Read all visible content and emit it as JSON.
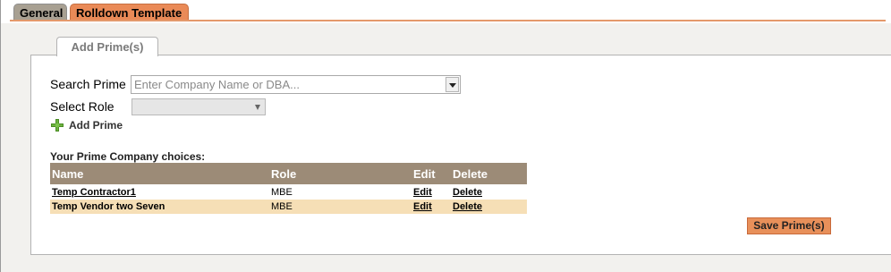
{
  "tabs": [
    {
      "label": "General",
      "active": false
    },
    {
      "label": "Rolldown Template",
      "active": true
    }
  ],
  "section": {
    "title": "Add Prime(s)"
  },
  "search": {
    "label": "Search Prime",
    "placeholder": "Enter Company Name or DBA...",
    "value": ""
  },
  "role": {
    "label": "Select Role",
    "selected": ""
  },
  "add_prime": {
    "label": "Add Prime",
    "icon": "plus-icon"
  },
  "choices": {
    "label": "Your Prime Company choices:",
    "columns": {
      "name": "Name",
      "role": "Role",
      "edit": "Edit",
      "delete": "Delete"
    },
    "rows": [
      {
        "name": "Temp Contractor1",
        "role": "MBE",
        "edit": "Edit",
        "delete": "Delete"
      },
      {
        "name": "Temp Vendor two Seven",
        "role": "MBE",
        "edit": "Edit",
        "delete": "Delete"
      }
    ]
  },
  "save_button": {
    "label": "Save Prime(s)"
  },
  "colors": {
    "accent": "#ea8a57",
    "header_bg": "#9c8b77",
    "alt_row": "#f6dfb6"
  }
}
